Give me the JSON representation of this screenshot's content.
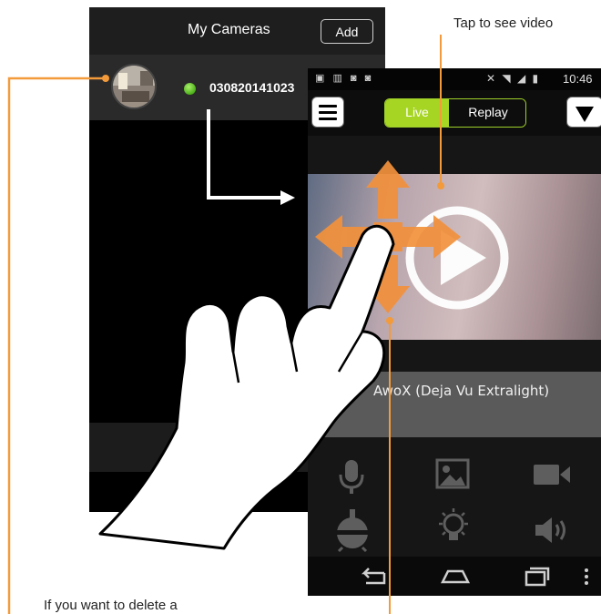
{
  "camera_list": {
    "title": "My Cameras",
    "add_label": "Add",
    "camera_id": "030820141023"
  },
  "live_view": {
    "status_time": "10:46",
    "tabs": {
      "live": "Live",
      "replay": "Replay"
    },
    "camera_name": "AwoX (Deja Vu Extralight)"
  },
  "annotations": {
    "tap_video": "Tap to see video",
    "delete_hint": "If you want to delete a"
  },
  "colors": {
    "callout": "#f39a3a",
    "accent_green": "#a6d523",
    "arrow_orange": "#f2913c"
  },
  "icons": {
    "control_icons": [
      "microphone-icon",
      "image-icon",
      "video-camera-icon",
      "ptz-joystick-icon",
      "light-bulb-icon",
      "speaker-icon"
    ],
    "nav_icons": [
      "back-icon",
      "home-icon",
      "recent-apps-icon",
      "more-options-icon"
    ]
  }
}
